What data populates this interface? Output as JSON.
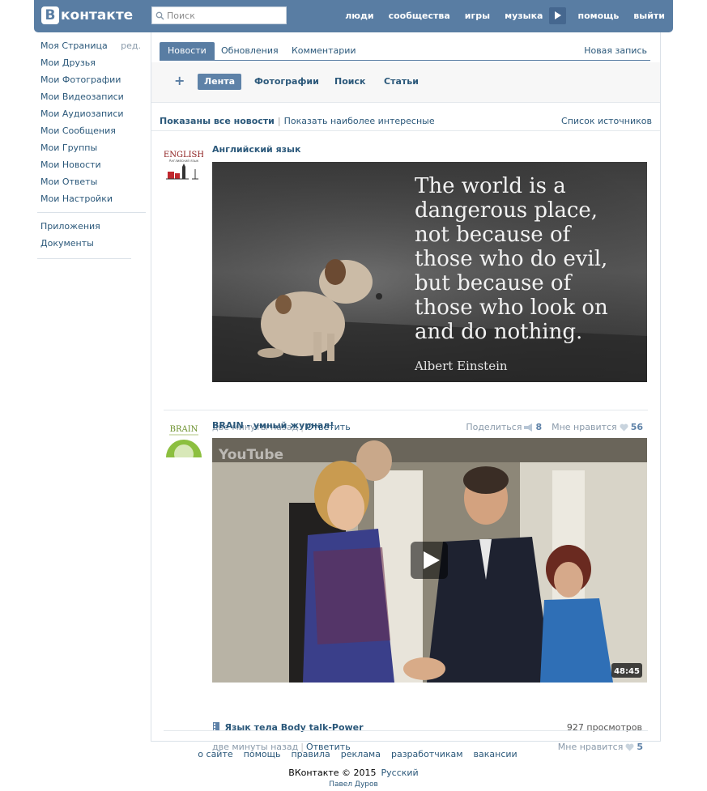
{
  "header": {
    "logo_text": "контакте",
    "logo_letter": "В",
    "search_placeholder": "Поиск",
    "nav": [
      "люди",
      "сообщества",
      "игры",
      "музыка",
      "помощь",
      "выйти"
    ]
  },
  "sidebar": {
    "edit_label": "ред.",
    "items": [
      {
        "label": "Моя Страница"
      },
      {
        "label": "Мои Друзья"
      },
      {
        "label": "Мои Фотографии"
      },
      {
        "label": "Мои Видеозаписи"
      },
      {
        "label": "Мои Аудиозаписи"
      },
      {
        "label": "Мои Сообщения"
      },
      {
        "label": "Мои Группы"
      },
      {
        "label": "Мои Новости"
      },
      {
        "label": "Мои Ответы"
      },
      {
        "label": "Мои Настройки"
      }
    ],
    "extra": [
      {
        "label": "Приложения"
      },
      {
        "label": "Документы"
      }
    ]
  },
  "tabs": {
    "items": [
      "Новости",
      "Обновления",
      "Комментарии"
    ],
    "active": "Новости",
    "new_post": "Новая запись"
  },
  "subtabs": {
    "plus": "+",
    "items": [
      "Лента",
      "Фотографии",
      "Поиск",
      "Статьи"
    ],
    "active": "Лента"
  },
  "filter": {
    "shown_all": "Показаны все новости",
    "show_interesting": "Показать наиболее интересные",
    "sources": "Список источников"
  },
  "posts": [
    {
      "author": "Английский язык",
      "avatar_text": "ENGLISH",
      "avatar_sub": "Английский язык",
      "quote_lines": [
        "The world is a",
        "dangerous place,",
        "not because of",
        "those who do evil,",
        "but because of",
        "those who look on",
        "and do nothing."
      ],
      "quote_author": "Albert Einstein",
      "time": "две минуты назад",
      "reply": "Ответить",
      "share_label": "Поделиться",
      "share_count": "8",
      "like_label": "Мне нравится",
      "like_count": "56"
    },
    {
      "author": "BRAIN - умный журнал!",
      "avatar_text": "BRAIN",
      "video_logo": "YouTube",
      "video_duration": "48:45",
      "video_title": "Язык тела Body talk-Power",
      "views": "927 просмотров",
      "time": "две минуты назад",
      "reply": "Ответить",
      "like_label": "Мне нравится",
      "like_count": "5"
    }
  ],
  "footer": {
    "links": [
      "о сайте",
      "помощь",
      "правила",
      "реклама",
      "разработчикам",
      "вакансии"
    ],
    "copyright": "ВКонтакте © 2015",
    "language": "Русский",
    "author": "Павел Дуров"
  }
}
